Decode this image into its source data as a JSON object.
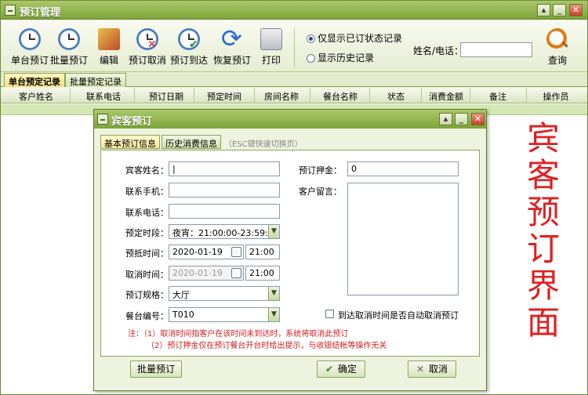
{
  "window": {
    "title": "预订管理"
  },
  "toolbar": {
    "buttons": [
      {
        "label": "单台预订",
        "icon": "clock-icon"
      },
      {
        "label": "批量预订",
        "icon": "calendar-book-icon"
      },
      {
        "label": "编辑",
        "icon": "edit-book-icon"
      },
      {
        "label": "预订取消",
        "icon": "clock-cancel-icon"
      },
      {
        "label": "预订到达",
        "icon": "clock-check-icon"
      },
      {
        "label": "恢复预订",
        "icon": "refresh-icon"
      },
      {
        "label": "打印",
        "icon": "printer-icon"
      }
    ],
    "radio_booked": "仅显示已订状态记录",
    "radio_history": "显示历史记录",
    "name_phone_label": "姓名/电话：",
    "name_phone_value": "",
    "search_label": "查询"
  },
  "main_tabs": [
    "单台预定记录",
    "批量预定记录"
  ],
  "grid": {
    "columns": [
      "客户姓名",
      "联系电话",
      "预订日期",
      "预定时间",
      "房间名称",
      "餐台名称",
      "状态",
      "消费金额",
      "备注",
      "操作员"
    ]
  },
  "side_caption": [
    "宾",
    "客",
    "预",
    "订",
    "界",
    "面"
  ],
  "dialog": {
    "title": "宾客预订",
    "tabs": [
      "基本预订信息",
      "历史消费信息"
    ],
    "hint": "（ESC键快速切换页）",
    "fields": {
      "guest_name_label": "宾客姓名：",
      "guest_name_value": "|",
      "mobile_label": "联系手机：",
      "mobile_value": "",
      "phone_label": "联系电话：",
      "phone_value": "",
      "period_label": "预定时段：",
      "period_value": "夜宵：21:00:00-23:59:5",
      "arrive_label": "预抵时间：",
      "arrive_date": "2020-01-19",
      "arrive_time": "21:00",
      "cancel_label": "取消时间：",
      "cancel_date": "2020-01-19",
      "cancel_time": "21:00",
      "spec_label": "预订规格：",
      "spec_value": "大厅",
      "table_no_label": "餐台编号：",
      "table_no_value": "T010",
      "deposit_label": "预订押金：",
      "deposit_value": "0",
      "message_label": "客户留言：",
      "auto_cancel_label": "到达取消时间是否自动取消预订"
    },
    "notes": [
      "注：（1）取消时间指客户在该时间未到达时，系统将取消此预订",
      "（2）预订押金仅在预订餐台开台时给出提示，与收银结帐等操作无关"
    ],
    "batch_button": "批量预订",
    "ok_button": "确定",
    "cancel_button": "取消"
  }
}
